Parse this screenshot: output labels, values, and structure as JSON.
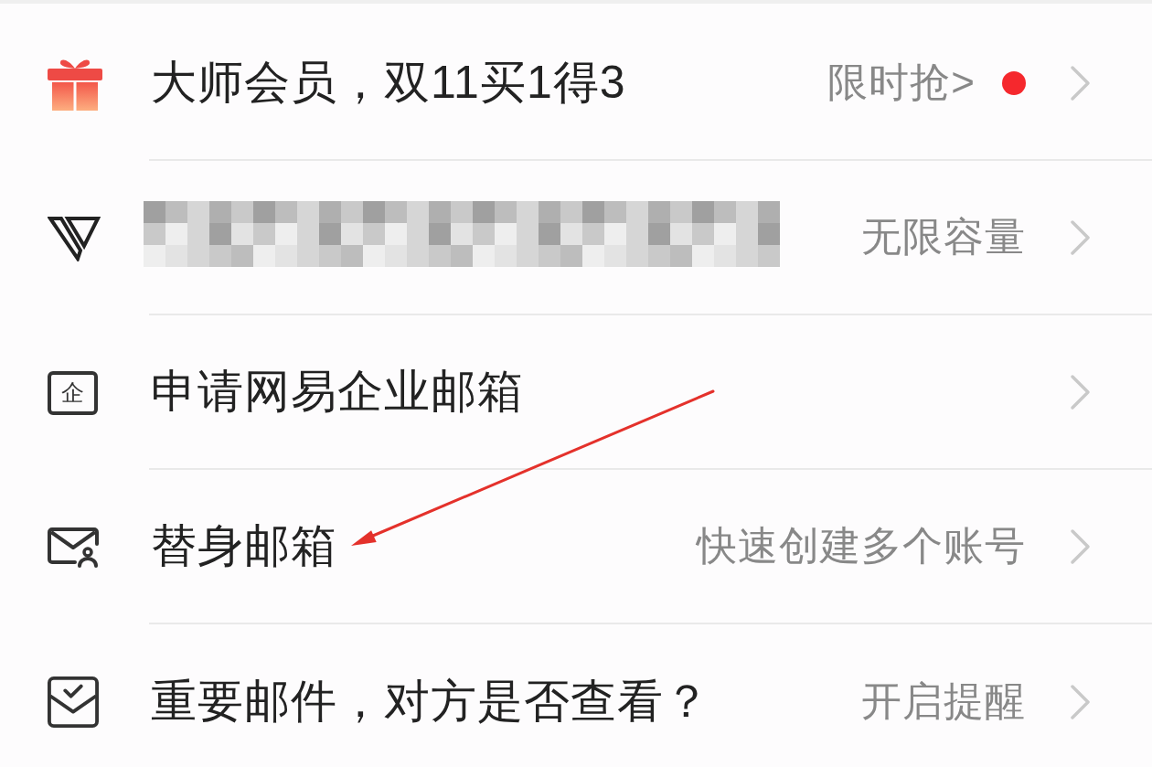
{
  "menu": {
    "items": [
      {
        "kind": "text",
        "title": "大师会员，双11买1得3",
        "detail": "限时抢>",
        "dot": true
      },
      {
        "kind": "redacted",
        "detail": "无限容量",
        "dot": false
      },
      {
        "kind": "text",
        "icon_char": "企",
        "title": "申请网易企业邮箱",
        "dot": false
      },
      {
        "kind": "text",
        "title": "替身邮箱",
        "detail": "快速创建多个账号",
        "dot": false
      },
      {
        "kind": "text",
        "title": "重要邮件，对方是否查看？",
        "detail": "开启提醒",
        "dot": false
      }
    ]
  }
}
